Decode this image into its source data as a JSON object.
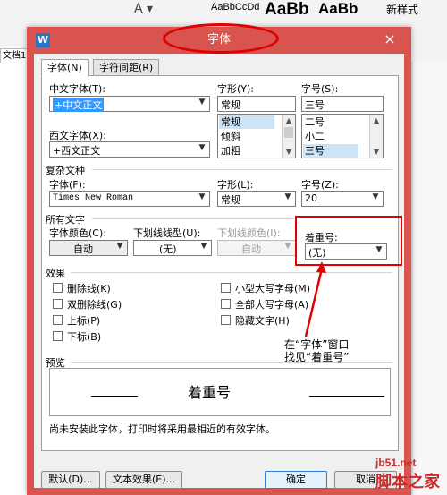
{
  "background": {
    "style_samples": [
      "AaBbCcDd",
      "AaBb",
      "AaBb",
      "新样式"
    ],
    "doc_tab": "文档1"
  },
  "dialog": {
    "title": "字体",
    "icon": "W",
    "close": "×",
    "tabs": [
      {
        "label": "字体(N)",
        "active": true
      },
      {
        "label": "字符间距(R)",
        "active": false
      }
    ],
    "chinese_font": {
      "label": "中文字体(T):",
      "value": "+中文正文"
    },
    "style": {
      "label": "字形(Y):",
      "value": "常规",
      "options": [
        "常规",
        "倾斜",
        "加粗"
      ]
    },
    "size": {
      "label": "字号(S):",
      "value": "三号",
      "options": [
        "二号",
        "小二",
        "三号"
      ]
    },
    "western_font": {
      "label": "西文字体(X):",
      "value": "+西文正文"
    },
    "complex": {
      "group": "复杂文种",
      "font_label": "字体(F):",
      "font_value": "Times New Roman",
      "style_label": "字形(L):",
      "style_value": "常规",
      "size_label": "字号(Z):",
      "size_value": "20"
    },
    "all_text": {
      "group": "所有文字",
      "color_label": "字体颜色(C):",
      "color_value": "自动",
      "underline_label": "下划线线型(U):",
      "underline_value": "(无)",
      "underline_color_label": "下划线颜色(I):",
      "underline_color_value": "自动",
      "emphasis_label": "着重号:",
      "emphasis_value": "(无)"
    },
    "effects": {
      "group": "效果",
      "left": [
        "删除线(K)",
        "双删除线(G)",
        "上标(P)",
        "下标(B)"
      ],
      "right": [
        "小型大写字母(M)",
        "全部大写字母(A)",
        "隐藏文字(H)"
      ]
    },
    "preview": {
      "group": "预览",
      "text": "着重号"
    },
    "note": "尚未安装此字体，打印时将采用最相近的有效字体。",
    "buttons": {
      "default": "默认(D)...",
      "text_effect": "文本效果(E)...",
      "ok": "确定",
      "cancel": "取消"
    }
  },
  "annotation": {
    "line1": "在“字体”窗口",
    "line2": "找见“着重号”"
  },
  "watermark": {
    "site": "jb51.net",
    "name": "脚本之家"
  },
  "colors": {
    "titlebar": "#d9534f",
    "highlight": "#e00000",
    "selection": "#3399ff"
  }
}
